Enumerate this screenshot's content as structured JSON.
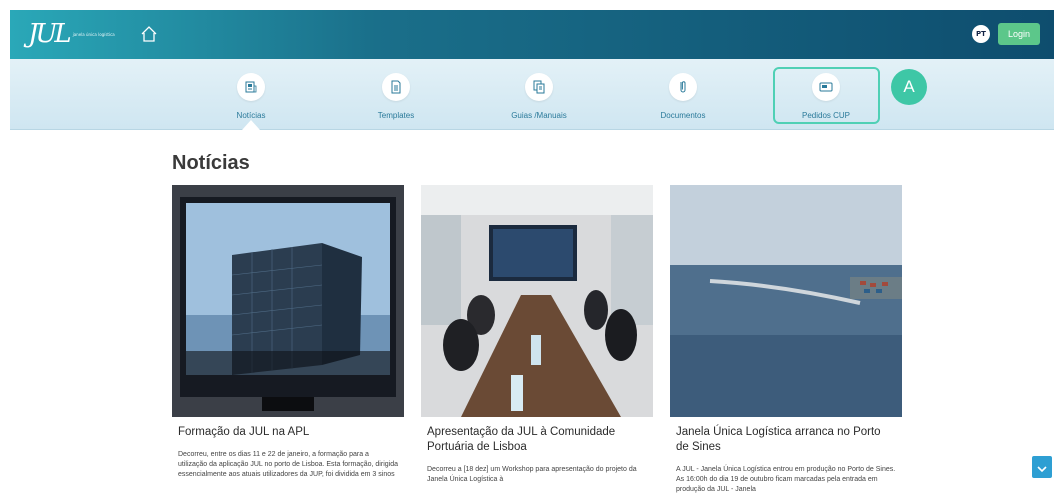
{
  "header": {
    "logo_mark": "JUL",
    "logo_subtitle": "janela única logística",
    "lang_label": "PT",
    "login_label": "Login"
  },
  "nav": {
    "items": [
      {
        "label": "Notícias",
        "icon": "news-icon"
      },
      {
        "label": "Templates",
        "icon": "template-icon"
      },
      {
        "label": "Guias /Manuais",
        "icon": "guides-icon"
      },
      {
        "label": "Documentos",
        "icon": "document-icon"
      },
      {
        "label": "Pedidos CUP",
        "icon": "card-icon"
      }
    ],
    "badge": "A"
  },
  "section_title": "Notícias",
  "cards": [
    {
      "title": "Formação da JUL na APL",
      "text": "Decorreu, entre os dias 11 e 22 de janeiro, a formação para a utilização da aplicação JUL no porto de Lisboa. Esta formação, dirigida essencialmente aos atuais utilizadores da JUP, foi dividida em 3 sinos"
    },
    {
      "title": "Apresentação da JUL à Comunidade Portuária de Lisboa",
      "text": "  Decorreu a [18 dez]  um Workshop para apresentação do projeto da Janela Única Logística à"
    },
    {
      "title": "Janela Única Logística arranca no Porto de Sines",
      "text": "A JUL - Janela Única Logística entrou em produção no Porto de Sines. As 16:00h do dia 19 de outubro ficam marcadas pela entrada em produção da JUL - Janela"
    }
  ],
  "colors": {
    "accent": "#3ec7a6",
    "login": "#5cc78a",
    "nav_text": "#2a7a9a"
  }
}
